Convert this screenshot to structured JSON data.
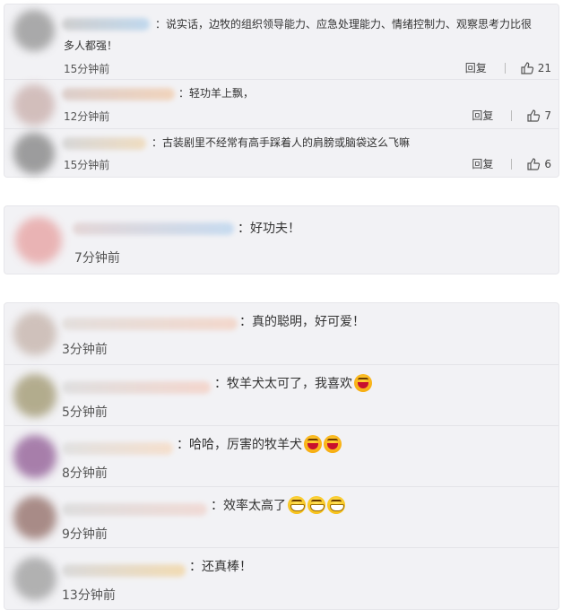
{
  "group1": {
    "comments": [
      {
        "text_line1": "：说实话，边牧的组织领导能力、应急处理能力、情绪控制力、观察思考力比很",
        "text_line2": "多人都强！",
        "time": "15分钟前",
        "reply": "回复",
        "likes": "21"
      },
      {
        "text": "：轻功羊上飘，",
        "time": "12分钟前",
        "reply": "回复",
        "likes": "7"
      },
      {
        "text": "：古装剧里不经常有高手踩着人的肩膀或脑袋这么飞嘛",
        "time": "15分钟前",
        "reply": "回复",
        "likes": "6"
      }
    ]
  },
  "group2": {
    "comments": [
      {
        "text": "：好功夫！",
        "time": "7分钟前"
      }
    ]
  },
  "group3": {
    "comments": [
      {
        "text": "：真的聪明，好可爱！",
        "time": "3分钟前"
      },
      {
        "text": "：牧羊犬太可了，我喜欢",
        "time": "5分钟前",
        "emojis": [
          "laugh"
        ]
      },
      {
        "text": "：哈哈，厉害的牧羊犬",
        "time": "8分钟前",
        "emojis": [
          "laugh",
          "laugh"
        ]
      },
      {
        "text": "：效率太高了",
        "time": "9分钟前",
        "emojis": [
          "grin",
          "grin",
          "grin"
        ]
      },
      {
        "text": "：还真棒！",
        "time": "13分钟前"
      }
    ]
  },
  "icons": {
    "like": "thumbs-up-icon",
    "laugh": "laughing-emoji-icon",
    "grin": "grinning-emoji-icon"
  },
  "colors": {
    "card_bg": "#f2f2f5",
    "divider": "#e3e3e8",
    "text": "#333333"
  }
}
